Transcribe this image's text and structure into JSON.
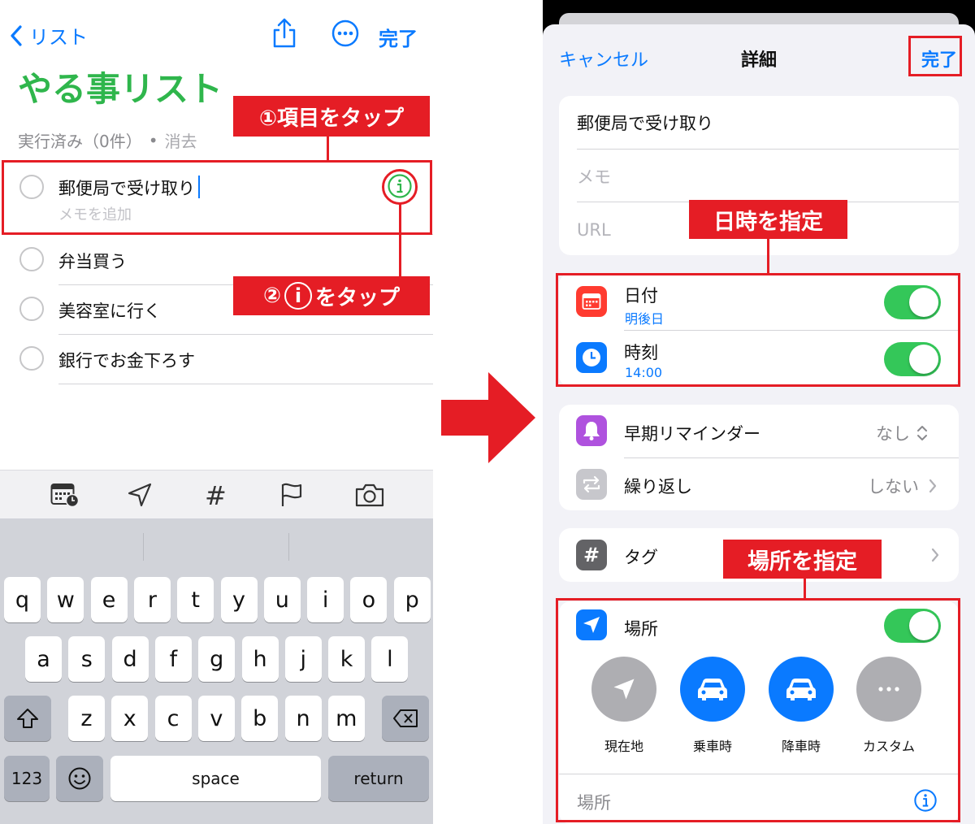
{
  "left": {
    "nav": {
      "back_label": "リスト",
      "done_label": "完了"
    },
    "title": "やる事リスト",
    "completed_label": "実行済み（0件）",
    "clear_label": "消去",
    "items": [
      {
        "title": "郵便局で受け取り",
        "note_placeholder": "メモを追加"
      },
      {
        "title": "弁当買う"
      },
      {
        "title": "美容室に行く"
      },
      {
        "title": "銀行でお金下ろす"
      }
    ],
    "keyboard": {
      "row1": [
        "q",
        "w",
        "e",
        "r",
        "t",
        "y",
        "u",
        "i",
        "o",
        "p"
      ],
      "row2": [
        "a",
        "s",
        "d",
        "f",
        "g",
        "h",
        "j",
        "k",
        "l"
      ],
      "row3": [
        "z",
        "x",
        "c",
        "v",
        "b",
        "n",
        "m"
      ],
      "numbers_key": "123",
      "space_key": "space",
      "return_key": "return"
    }
  },
  "annotations": {
    "tap_item": "①項目をタップ",
    "tap_info_prefix": "②",
    "tap_info_glyph": "i",
    "tap_info_suffix": "をタップ",
    "set_datetime": "日時を指定",
    "set_location": "場所を指定"
  },
  "right": {
    "header": {
      "cancel": "キャンセル",
      "title": "詳細",
      "done": "完了"
    },
    "title_field": "郵便局で受け取り",
    "memo_placeholder": "メモ",
    "url_placeholder": "URL",
    "date": {
      "label": "日付",
      "value": "明後日",
      "enabled": true
    },
    "time": {
      "label": "時刻",
      "value": "14:00",
      "enabled": true
    },
    "early_reminder": {
      "label": "早期リマインダー",
      "value": "なし"
    },
    "repeat": {
      "label": "繰り返し",
      "value": "しない"
    },
    "tags": {
      "label": "タグ"
    },
    "location": {
      "label": "場所",
      "enabled": true,
      "options": [
        "現在地",
        "乗車時",
        "降車時",
        "カスタム"
      ],
      "placeholder": "場所"
    }
  },
  "colors": {
    "accent_blue": "#0a7aff",
    "title_green": "#2fb64c",
    "toggle_green": "#34c759",
    "annotation_red": "#e51d25"
  }
}
